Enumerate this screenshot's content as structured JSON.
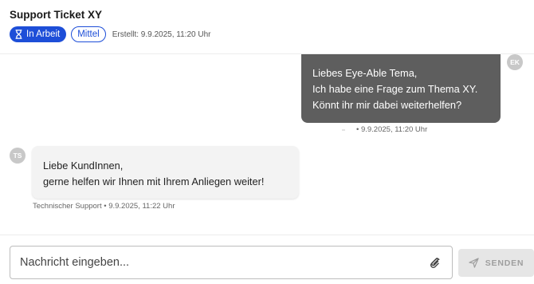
{
  "ticket": {
    "title": "Support Ticket XY",
    "status_label": "In Arbeit",
    "status_icon": "hourglass-icon",
    "priority_label": "Mittel",
    "created_text": "Erstellt: 9.9.2025, 11:20 Uhr",
    "accent_color": "#1d4ed8"
  },
  "messages": [
    {
      "direction": "outgoing",
      "avatar_initials": "EK",
      "lines": [
        "Liebes Eye-Able Tema,",
        "Ich habe eine Frage zum Thema XY.",
        "Könnt ihr mir dabei weiterhelfen?"
      ],
      "meta": "• 9.9.2025, 11:20 Uhr",
      "bubble_color": "#5e5e5e"
    },
    {
      "direction": "incoming",
      "avatar_initials": "TS",
      "lines": [
        "Liebe KundInnen,",
        "gerne helfen wir Ihnen mit Ihrem Anliegen weiter!"
      ],
      "meta": "Technischer Support • 9.9.2025, 11:22 Uhr",
      "bubble_color": "#f3f3f3"
    }
  ],
  "composer": {
    "placeholder": "Nachricht eingeben...",
    "value": "",
    "attach_icon": "paperclip-icon",
    "send_label": "SENDEN",
    "send_icon": "send-icon",
    "send_enabled": false
  }
}
